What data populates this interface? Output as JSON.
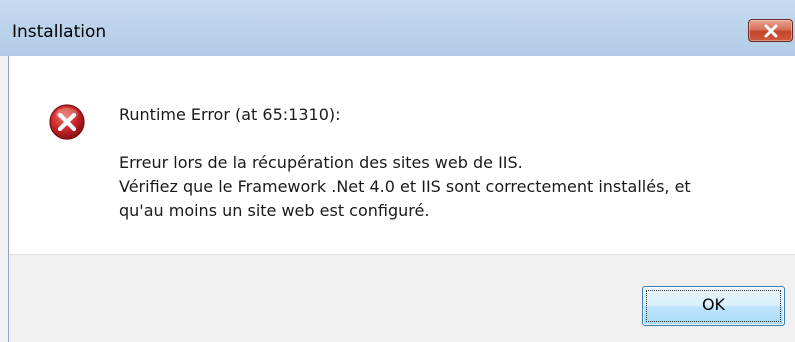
{
  "dialog": {
    "title": "Installation",
    "error_heading": "Runtime Error (at 65:1310):",
    "message_lines": [
      "Erreur lors de la récupération des sites web de IIS.",
      "Vérifiez que le Framework .Net 4.0 et IIS sont correctement installés, et",
      "qu'au moins un site web est configuré."
    ],
    "ok_label": "OK",
    "icons": {
      "close": "close-icon",
      "error": "error-icon"
    }
  },
  "colors": {
    "titlebar": "#bcd3ec",
    "close_button": "#c3462c",
    "error_icon": "#c8262a",
    "ok_button_border": "#3c7fb1",
    "footer": "#f0f0f0"
  }
}
